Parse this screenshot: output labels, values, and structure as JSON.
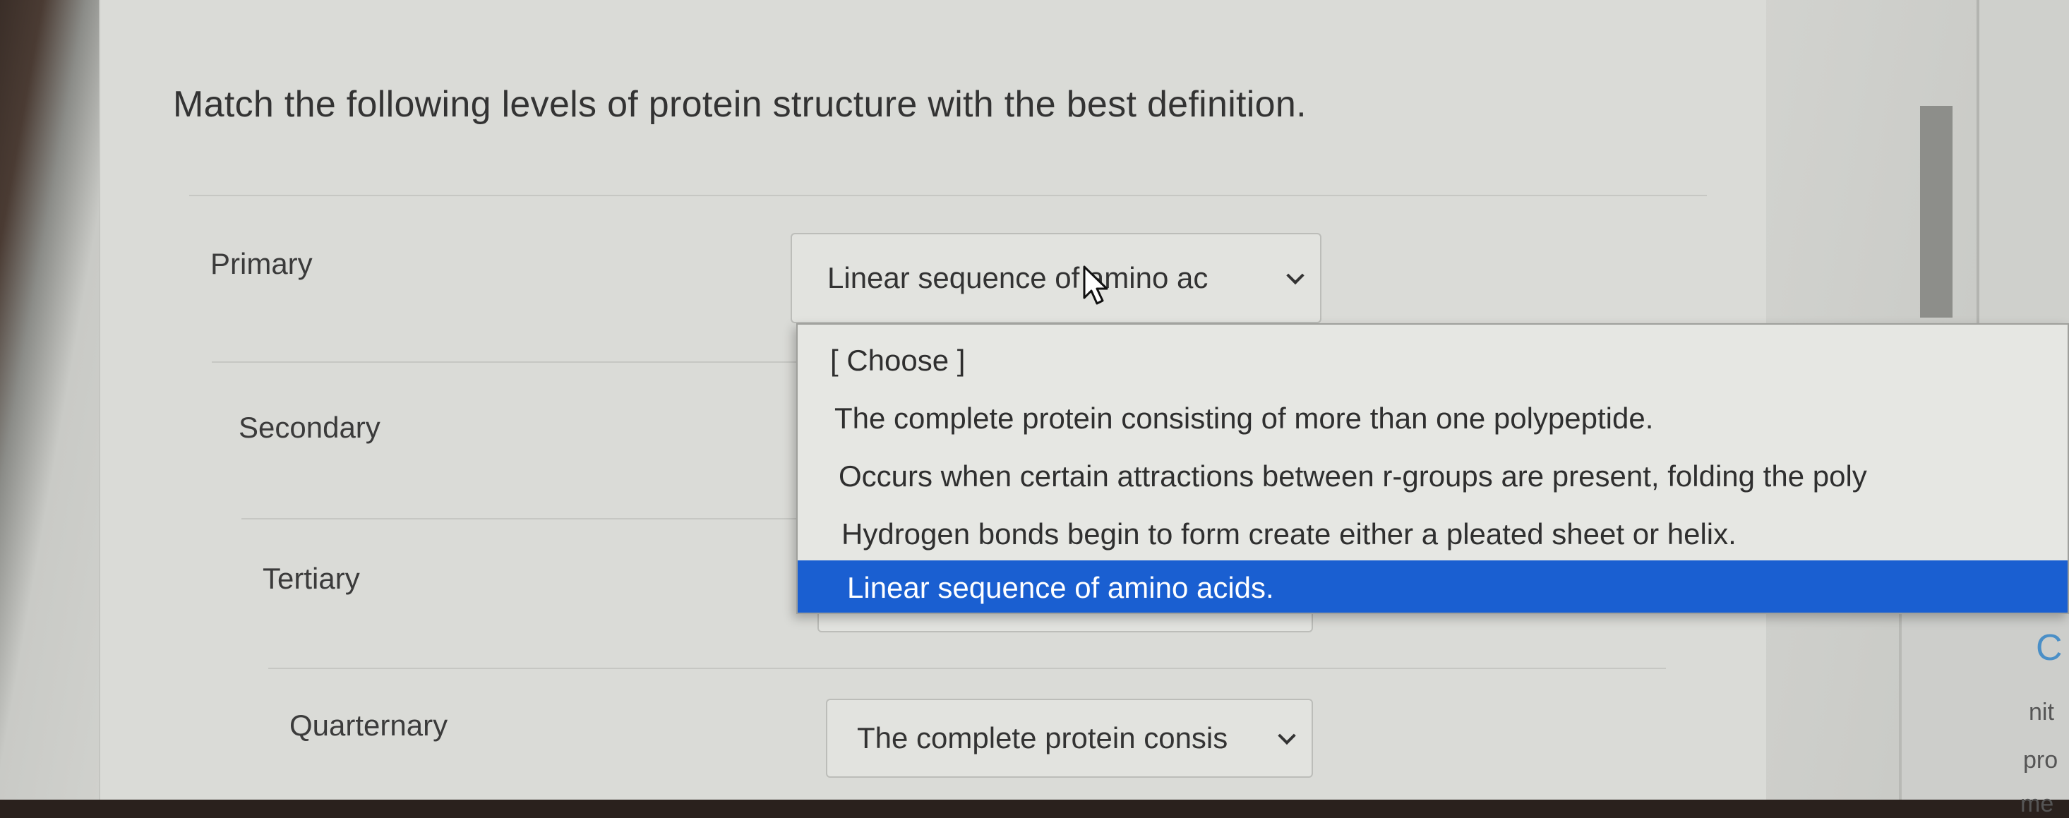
{
  "question": {
    "title": "Match the following levels of protein structure with the best definition."
  },
  "rows": [
    {
      "label": "Primary",
      "selected_value": "Linear sequence of amino ac"
    },
    {
      "label": "Secondary",
      "selected_value": ""
    },
    {
      "label": "Tertiary",
      "selected_value": ""
    },
    {
      "label": "Quarternary",
      "selected_value": "The complete protein consis"
    }
  ],
  "dropdown": {
    "options": [
      "[ Choose ]",
      "The complete protein consisting of more than one polypeptide.",
      "Occurs when certain attractions between r-groups are present, folding the poly",
      "Hydrogen bonds begin to form create either a pleated sheet or helix.",
      "Linear sequence of amino acids."
    ],
    "highlighted_index": 4
  },
  "side_panel": {
    "fragments": [
      "C",
      "nit",
      "pro",
      "me"
    ]
  },
  "colors": {
    "highlight": "#1a5fd1",
    "page_background": "#dadbd7",
    "text": "#333333"
  }
}
